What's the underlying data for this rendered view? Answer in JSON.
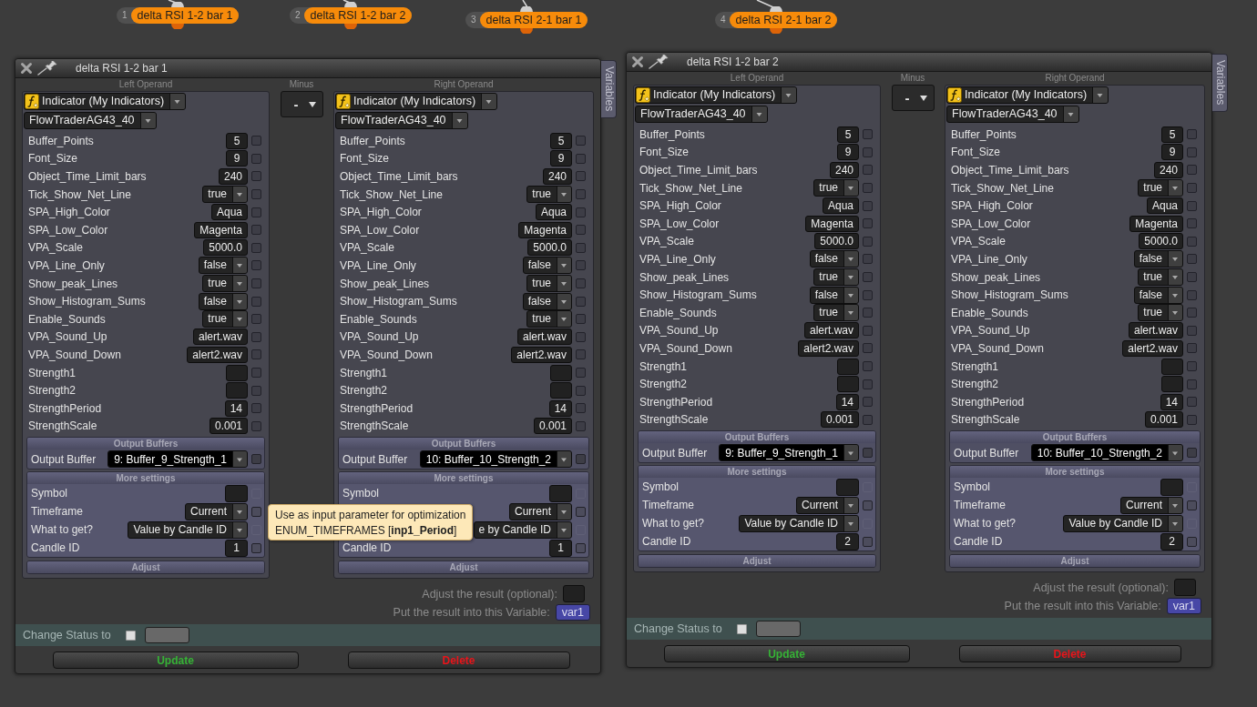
{
  "nodes": [
    {
      "number": "1",
      "label": "delta RSI 1-2 bar 1"
    },
    {
      "number": "2",
      "label": "delta RSI 1-2 bar 2"
    },
    {
      "number": "3",
      "label": "delta RSI 2-1 bar 1"
    },
    {
      "number": "4",
      "label": "delta RSI 2-1 bar 2"
    }
  ],
  "dialogs": [
    {
      "title": "delta RSI 1-2 bar 1",
      "variables_tab": "Variables",
      "operator": {
        "label": "Minus",
        "value": "-"
      },
      "operands": [
        {
          "heading": "Left Operand",
          "source": "Indicator (My Indicators)",
          "indicator": "FlowTraderAG43_40",
          "params": [
            {
              "label": "Buffer_Points",
              "kind": "input",
              "value": "5",
              "checked": false
            },
            {
              "label": "Font_Size",
              "kind": "input",
              "value": "9",
              "checked": false
            },
            {
              "label": "Object_Time_Limit_bars",
              "kind": "input",
              "value": "240",
              "checked": false
            },
            {
              "label": "Tick_Show_Net_Line",
              "kind": "select",
              "value": "true",
              "checked": false
            },
            {
              "label": "SPA_High_Color",
              "kind": "input",
              "value": "Aqua",
              "checked": false
            },
            {
              "label": "SPA_Low_Color",
              "kind": "input",
              "value": "Magenta",
              "checked": false
            },
            {
              "label": "VPA_Scale",
              "kind": "input",
              "value": "5000.0",
              "checked": false
            },
            {
              "label": "VPA_Line_Only",
              "kind": "select",
              "value": "false",
              "checked": false
            },
            {
              "label": "Show_peak_Lines",
              "kind": "select",
              "value": "true",
              "checked": false
            },
            {
              "label": "Show_Histogram_Sums",
              "kind": "select",
              "value": "false",
              "checked": false
            },
            {
              "label": "Enable_Sounds",
              "kind": "select",
              "value": "true",
              "checked": false
            },
            {
              "label": "VPA_Sound_Up",
              "kind": "input",
              "value": "alert.wav",
              "checked": false
            },
            {
              "label": "VPA_Sound_Down",
              "kind": "input",
              "value": "alert2.wav",
              "checked": false
            },
            {
              "label": "Strength1",
              "kind": "input",
              "checked": false
            },
            {
              "label": "Strength2",
              "kind": "input",
              "checked": false
            },
            {
              "label": "StrengthPeriod",
              "kind": "input",
              "value": "14",
              "checked": false
            },
            {
              "label": "StrengthScale",
              "kind": "input",
              "value": "0.001",
              "checked": false
            }
          ],
          "output_buffers": {
            "heading": "Output Buffers",
            "label": "Output Buffer",
            "value": "9: Buffer_9_Strength_1",
            "checked": false
          },
          "more_settings": {
            "heading": "More settings",
            "params": [
              {
                "label": "Symbol",
                "kind": "input",
                "checked": false,
                "disabled": true
              },
              {
                "label": "Timeframe",
                "kind": "select",
                "value": "Current",
                "checked": false,
                "disabled": false
              },
              {
                "label": "What to get?",
                "kind": "select",
                "value": "Value by Candle ID",
                "checked": false,
                "disabled": true
              },
              {
                "label": "Candle ID",
                "kind": "input",
                "value": "1",
                "checked": false,
                "disabled": false
              }
            ]
          },
          "adjust": {
            "heading": "Adjust"
          }
        },
        {
          "heading": "Right Operand",
          "source": "Indicator (My Indicators)",
          "indicator": "FlowTraderAG43_40",
          "params": [
            {
              "label": "Buffer_Points",
              "kind": "input",
              "value": "5",
              "checked": false
            },
            {
              "label": "Font_Size",
              "kind": "input",
              "value": "9",
              "checked": false
            },
            {
              "label": "Object_Time_Limit_bars",
              "kind": "input",
              "value": "240",
              "checked": false
            },
            {
              "label": "Tick_Show_Net_Line",
              "kind": "select",
              "value": "true",
              "checked": false
            },
            {
              "label": "SPA_High_Color",
              "kind": "input",
              "value": "Aqua",
              "checked": false
            },
            {
              "label": "SPA_Low_Color",
              "kind": "input",
              "value": "Magenta",
              "checked": false
            },
            {
              "label": "VPA_Scale",
              "kind": "input",
              "value": "5000.0",
              "checked": false
            },
            {
              "label": "VPA_Line_Only",
              "kind": "select",
              "value": "false",
              "checked": false
            },
            {
              "label": "Show_peak_Lines",
              "kind": "select",
              "value": "true",
              "checked": false
            },
            {
              "label": "Show_Histogram_Sums",
              "kind": "select",
              "value": "false",
              "checked": false
            },
            {
              "label": "Enable_Sounds",
              "kind": "select",
              "value": "true",
              "checked": false
            },
            {
              "label": "VPA_Sound_Up",
              "kind": "input",
              "value": "alert.wav",
              "checked": false
            },
            {
              "label": "VPA_Sound_Down",
              "kind": "input",
              "value": "alert2.wav",
              "checked": false
            },
            {
              "label": "Strength1",
              "kind": "input",
              "checked": false
            },
            {
              "label": "Strength2",
              "kind": "input",
              "checked": false
            },
            {
              "label": "StrengthPeriod",
              "kind": "input",
              "value": "14",
              "checked": false
            },
            {
              "label": "StrengthScale",
              "kind": "input",
              "value": "0.001",
              "checked": false
            }
          ],
          "output_buffers": {
            "heading": "Output Buffers",
            "label": "Output Buffer",
            "value": "10: Buffer_10_Strength_2",
            "checked": false
          },
          "more_settings": {
            "heading": "More settings",
            "params": [
              {
                "label": "Symbol",
                "kind": "input",
                "checked": false,
                "disabled": true
              },
              {
                "kind": "select",
                "value": "Current",
                "checked": false,
                "disabled": false
              },
              {
                "kind": "select",
                "value": "e by Candle ID",
                "checked": false,
                "disabled": true
              },
              {
                "label": "Candle ID",
                "kind": "input",
                "value": "1",
                "checked": false,
                "disabled": false
              }
            ]
          },
          "adjust": {
            "heading": "Adjust"
          }
        }
      ],
      "adjust_result": {
        "label": "Adjust the result (optional):"
      },
      "result_variable": {
        "label": "Put the result into this Variable:",
        "value": "var1"
      },
      "change_status": {
        "label": "Change Status to",
        "checked": false
      },
      "buttons": [
        {
          "label": "Update",
          "kind": "confirm"
        },
        {
          "label": "Delete",
          "kind": "danger"
        }
      ],
      "tooltip": {
        "lines": [
          "Use as input parameter for optimization",
          "ENUM_TIMEFRAMES [**inp1_Period**]"
        ]
      }
    },
    {
      "title": "delta RSI 1-2 bar 2",
      "variables_tab": "Variables",
      "operator": {
        "label": "Minus",
        "value": "-"
      },
      "operands": [
        {
          "heading": "Left Operand",
          "source": "Indicator (My Indicators)",
          "indicator": "FlowTraderAG43_40",
          "params": [
            {
              "label": "Buffer_Points",
              "kind": "input",
              "value": "5",
              "checked": false
            },
            {
              "label": "Font_Size",
              "kind": "input",
              "value": "9",
              "checked": false
            },
            {
              "label": "Object_Time_Limit_bars",
              "kind": "input",
              "value": "240",
              "checked": false
            },
            {
              "label": "Tick_Show_Net_Line",
              "kind": "select",
              "value": "true",
              "checked": false
            },
            {
              "label": "SPA_High_Color",
              "kind": "input",
              "value": "Aqua",
              "checked": false
            },
            {
              "label": "SPA_Low_Color",
              "kind": "input",
              "value": "Magenta",
              "checked": false
            },
            {
              "label": "VPA_Scale",
              "kind": "input",
              "value": "5000.0",
              "checked": false
            },
            {
              "label": "VPA_Line_Only",
              "kind": "select",
              "value": "false",
              "checked": false
            },
            {
              "label": "Show_peak_Lines",
              "kind": "select",
              "value": "true",
              "checked": false
            },
            {
              "label": "Show_Histogram_Sums",
              "kind": "select",
              "value": "false",
              "checked": false
            },
            {
              "label": "Enable_Sounds",
              "kind": "select",
              "value": "true",
              "checked": false
            },
            {
              "label": "VPA_Sound_Up",
              "kind": "input",
              "value": "alert.wav",
              "checked": false
            },
            {
              "label": "VPA_Sound_Down",
              "kind": "input",
              "value": "alert2.wav",
              "checked": false
            },
            {
              "label": "Strength1",
              "kind": "input",
              "checked": false
            },
            {
              "label": "Strength2",
              "kind": "input",
              "checked": false
            },
            {
              "label": "StrengthPeriod",
              "kind": "input",
              "value": "14",
              "checked": false
            },
            {
              "label": "StrengthScale",
              "kind": "input",
              "value": "0.001",
              "checked": false
            }
          ],
          "output_buffers": {
            "heading": "Output Buffers",
            "label": "Output Buffer",
            "value": "9: Buffer_9_Strength_1",
            "checked": false
          },
          "more_settings": {
            "heading": "More settings",
            "params": [
              {
                "label": "Symbol",
                "kind": "input",
                "checked": false,
                "disabled": true
              },
              {
                "label": "Timeframe",
                "kind": "select",
                "value": "Current",
                "checked": false,
                "disabled": false
              },
              {
                "label": "What to get?",
                "kind": "select",
                "value": "Value by Candle ID",
                "checked": false,
                "disabled": true
              },
              {
                "label": "Candle ID",
                "kind": "input",
                "value": "2",
                "checked": false,
                "disabled": false
              }
            ]
          },
          "adjust": {
            "heading": "Adjust"
          }
        },
        {
          "heading": "Right Operand",
          "source": "Indicator (My Indicators)",
          "indicator": "FlowTraderAG43_40",
          "params": [
            {
              "label": "Buffer_Points",
              "kind": "input",
              "value": "5",
              "checked": false
            },
            {
              "label": "Font_Size",
              "kind": "input",
              "value": "9",
              "checked": false
            },
            {
              "label": "Object_Time_Limit_bars",
              "kind": "input",
              "value": "240",
              "checked": false
            },
            {
              "label": "Tick_Show_Net_Line",
              "kind": "select",
              "value": "true",
              "checked": false
            },
            {
              "label": "SPA_High_Color",
              "kind": "input",
              "value": "Aqua",
              "checked": false
            },
            {
              "label": "SPA_Low_Color",
              "kind": "input",
              "value": "Magenta",
              "checked": false
            },
            {
              "label": "VPA_Scale",
              "kind": "input",
              "value": "5000.0",
              "checked": false
            },
            {
              "label": "VPA_Line_Only",
              "kind": "select",
              "value": "false",
              "checked": false
            },
            {
              "label": "Show_peak_Lines",
              "kind": "select",
              "value": "true",
              "checked": false
            },
            {
              "label": "Show_Histogram_Sums",
              "kind": "select",
              "value": "false",
              "checked": false
            },
            {
              "label": "Enable_Sounds",
              "kind": "select",
              "value": "true",
              "checked": false
            },
            {
              "label": "VPA_Sound_Up",
              "kind": "input",
              "value": "alert.wav",
              "checked": false
            },
            {
              "label": "VPA_Sound_Down",
              "kind": "input",
              "value": "alert2.wav",
              "checked": false
            },
            {
              "label": "Strength1",
              "kind": "input",
              "checked": false
            },
            {
              "label": "Strength2",
              "kind": "input",
              "checked": false
            },
            {
              "label": "StrengthPeriod",
              "kind": "input",
              "value": "14",
              "checked": false
            },
            {
              "label": "StrengthScale",
              "kind": "input",
              "value": "0.001",
              "checked": false
            }
          ],
          "output_buffers": {
            "heading": "Output Buffers",
            "label": "Output Buffer",
            "value": "10: Buffer_10_Strength_2",
            "checked": false
          },
          "more_settings": {
            "heading": "More settings",
            "params": [
              {
                "label": "Symbol",
                "kind": "input",
                "checked": false,
                "disabled": true
              },
              {
                "label": "Timeframe",
                "kind": "select",
                "value": "Current",
                "checked": false,
                "disabled": false
              },
              {
                "label": "What to get?",
                "kind": "select",
                "value": "Value by Candle ID",
                "checked": false,
                "disabled": true
              },
              {
                "label": "Candle ID",
                "kind": "input",
                "value": "2",
                "checked": false,
                "disabled": false
              }
            ]
          },
          "adjust": {
            "heading": "Adjust"
          }
        }
      ],
      "adjust_result": {
        "label": "Adjust the result (optional):"
      },
      "result_variable": {
        "label": "Put the result into this Variable:",
        "value": "var1"
      },
      "change_status": {
        "label": "Change Status to",
        "checked": false
      },
      "buttons": [
        {
          "label": "Update",
          "kind": "confirm"
        },
        {
          "label": "Delete",
          "kind": "danger"
        }
      ]
    }
  ]
}
